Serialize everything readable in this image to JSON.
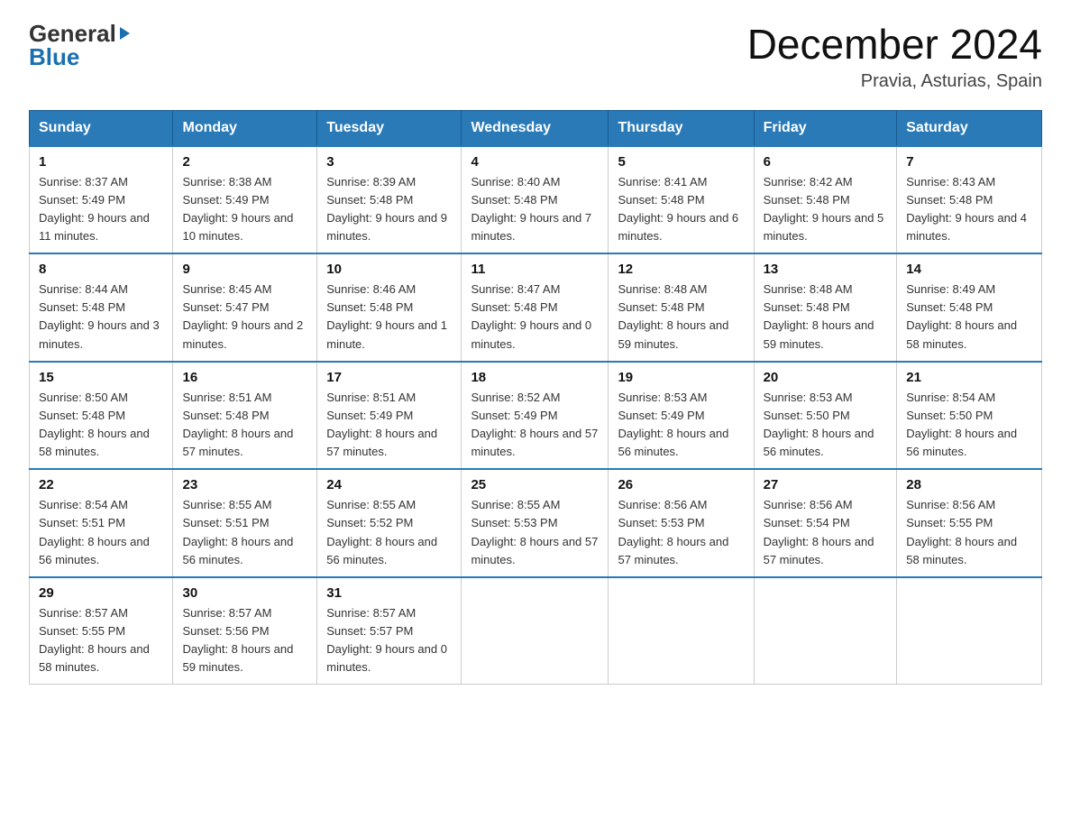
{
  "header": {
    "month_year": "December 2024",
    "location": "Pravia, Asturias, Spain",
    "logo_general": "General",
    "logo_blue": "Blue"
  },
  "days_of_week": [
    "Sunday",
    "Monday",
    "Tuesday",
    "Wednesday",
    "Thursday",
    "Friday",
    "Saturday"
  ],
  "weeks": [
    [
      {
        "day": "1",
        "sunrise": "8:37 AM",
        "sunset": "5:49 PM",
        "daylight": "9 hours and 11 minutes."
      },
      {
        "day": "2",
        "sunrise": "8:38 AM",
        "sunset": "5:49 PM",
        "daylight": "9 hours and 10 minutes."
      },
      {
        "day": "3",
        "sunrise": "8:39 AM",
        "sunset": "5:48 PM",
        "daylight": "9 hours and 9 minutes."
      },
      {
        "day": "4",
        "sunrise": "8:40 AM",
        "sunset": "5:48 PM",
        "daylight": "9 hours and 7 minutes."
      },
      {
        "day": "5",
        "sunrise": "8:41 AM",
        "sunset": "5:48 PM",
        "daylight": "9 hours and 6 minutes."
      },
      {
        "day": "6",
        "sunrise": "8:42 AM",
        "sunset": "5:48 PM",
        "daylight": "9 hours and 5 minutes."
      },
      {
        "day": "7",
        "sunrise": "8:43 AM",
        "sunset": "5:48 PM",
        "daylight": "9 hours and 4 minutes."
      }
    ],
    [
      {
        "day": "8",
        "sunrise": "8:44 AM",
        "sunset": "5:48 PM",
        "daylight": "9 hours and 3 minutes."
      },
      {
        "day": "9",
        "sunrise": "8:45 AM",
        "sunset": "5:47 PM",
        "daylight": "9 hours and 2 minutes."
      },
      {
        "day": "10",
        "sunrise": "8:46 AM",
        "sunset": "5:48 PM",
        "daylight": "9 hours and 1 minute."
      },
      {
        "day": "11",
        "sunrise": "8:47 AM",
        "sunset": "5:48 PM",
        "daylight": "9 hours and 0 minutes."
      },
      {
        "day": "12",
        "sunrise": "8:48 AM",
        "sunset": "5:48 PM",
        "daylight": "8 hours and 59 minutes."
      },
      {
        "day": "13",
        "sunrise": "8:48 AM",
        "sunset": "5:48 PM",
        "daylight": "8 hours and 59 minutes."
      },
      {
        "day": "14",
        "sunrise": "8:49 AM",
        "sunset": "5:48 PM",
        "daylight": "8 hours and 58 minutes."
      }
    ],
    [
      {
        "day": "15",
        "sunrise": "8:50 AM",
        "sunset": "5:48 PM",
        "daylight": "8 hours and 58 minutes."
      },
      {
        "day": "16",
        "sunrise": "8:51 AM",
        "sunset": "5:48 PM",
        "daylight": "8 hours and 57 minutes."
      },
      {
        "day": "17",
        "sunrise": "8:51 AM",
        "sunset": "5:49 PM",
        "daylight": "8 hours and 57 minutes."
      },
      {
        "day": "18",
        "sunrise": "8:52 AM",
        "sunset": "5:49 PM",
        "daylight": "8 hours and 57 minutes."
      },
      {
        "day": "19",
        "sunrise": "8:53 AM",
        "sunset": "5:49 PM",
        "daylight": "8 hours and 56 minutes."
      },
      {
        "day": "20",
        "sunrise": "8:53 AM",
        "sunset": "5:50 PM",
        "daylight": "8 hours and 56 minutes."
      },
      {
        "day": "21",
        "sunrise": "8:54 AM",
        "sunset": "5:50 PM",
        "daylight": "8 hours and 56 minutes."
      }
    ],
    [
      {
        "day": "22",
        "sunrise": "8:54 AM",
        "sunset": "5:51 PM",
        "daylight": "8 hours and 56 minutes."
      },
      {
        "day": "23",
        "sunrise": "8:55 AM",
        "sunset": "5:51 PM",
        "daylight": "8 hours and 56 minutes."
      },
      {
        "day": "24",
        "sunrise": "8:55 AM",
        "sunset": "5:52 PM",
        "daylight": "8 hours and 56 minutes."
      },
      {
        "day": "25",
        "sunrise": "8:55 AM",
        "sunset": "5:53 PM",
        "daylight": "8 hours and 57 minutes."
      },
      {
        "day": "26",
        "sunrise": "8:56 AM",
        "sunset": "5:53 PM",
        "daylight": "8 hours and 57 minutes."
      },
      {
        "day": "27",
        "sunrise": "8:56 AM",
        "sunset": "5:54 PM",
        "daylight": "8 hours and 57 minutes."
      },
      {
        "day": "28",
        "sunrise": "8:56 AM",
        "sunset": "5:55 PM",
        "daylight": "8 hours and 58 minutes."
      }
    ],
    [
      {
        "day": "29",
        "sunrise": "8:57 AM",
        "sunset": "5:55 PM",
        "daylight": "8 hours and 58 minutes."
      },
      {
        "day": "30",
        "sunrise": "8:57 AM",
        "sunset": "5:56 PM",
        "daylight": "8 hours and 59 minutes."
      },
      {
        "day": "31",
        "sunrise": "8:57 AM",
        "sunset": "5:57 PM",
        "daylight": "9 hours and 0 minutes."
      },
      null,
      null,
      null,
      null
    ]
  ],
  "labels": {
    "sunrise_prefix": "Sunrise: ",
    "sunset_prefix": "Sunset: ",
    "daylight_prefix": "Daylight: "
  }
}
